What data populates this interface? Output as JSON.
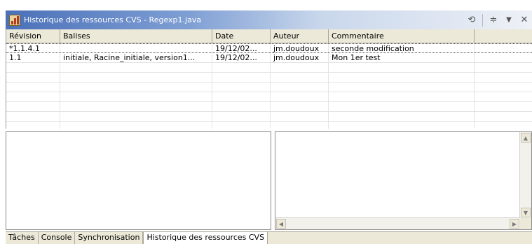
{
  "window": {
    "title": "Historique des ressources CVS - Regexp1.java",
    "tools": [
      {
        "icon": "link-editor-icon",
        "glyph": "⟲"
      },
      {
        "icon": "filter-icon",
        "glyph": "≑"
      },
      {
        "icon": "view-menu-icon",
        "glyph": "▼"
      },
      {
        "icon": "close-icon",
        "glyph": "✕"
      }
    ]
  },
  "table": {
    "columns": [
      "Révision",
      "Balises",
      "Date",
      "Auteur",
      "Commentaire"
    ],
    "rows": [
      {
        "revision": "*1.1.4.1",
        "tags": "",
        "date": "19/12/02...",
        "author": "jm.doudoux",
        "comment": "seconde modification"
      },
      {
        "revision": "1.1",
        "tags": "initiale, Racine_initiale, version1...",
        "date": "19/12/02...",
        "author": "jm.doudoux",
        "comment": "Mon 1er test"
      }
    ]
  },
  "tabs": [
    {
      "label": "Tâches",
      "active": false
    },
    {
      "label": "Console",
      "active": false
    },
    {
      "label": "Synchronisation",
      "active": false
    },
    {
      "label": "Historique des ressources CVS",
      "active": true
    }
  ]
}
